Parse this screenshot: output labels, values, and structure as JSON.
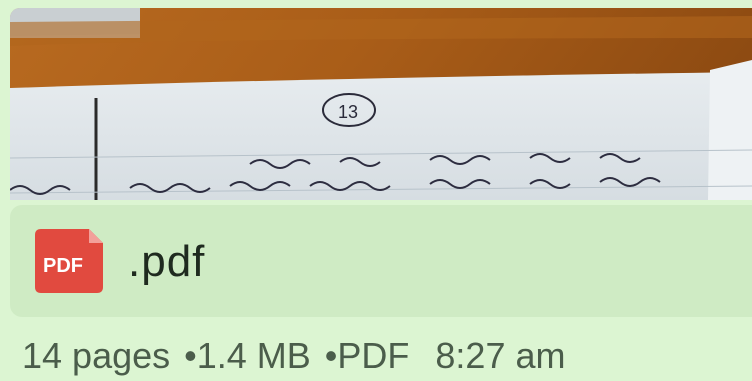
{
  "message": {
    "preview": {
      "page_number": "13"
    },
    "file": {
      "icon": "pdf-icon",
      "icon_label": "PDF",
      "name": ".pdf",
      "accent_color": "#e0483f"
    },
    "meta": {
      "pages": "14 pages",
      "size": "1.4 MB",
      "type": "PDF",
      "time": "8:27 am",
      "separator": "•"
    },
    "colors": {
      "bubble": "#dcf5d2",
      "file_row": "#cfebc4"
    }
  }
}
